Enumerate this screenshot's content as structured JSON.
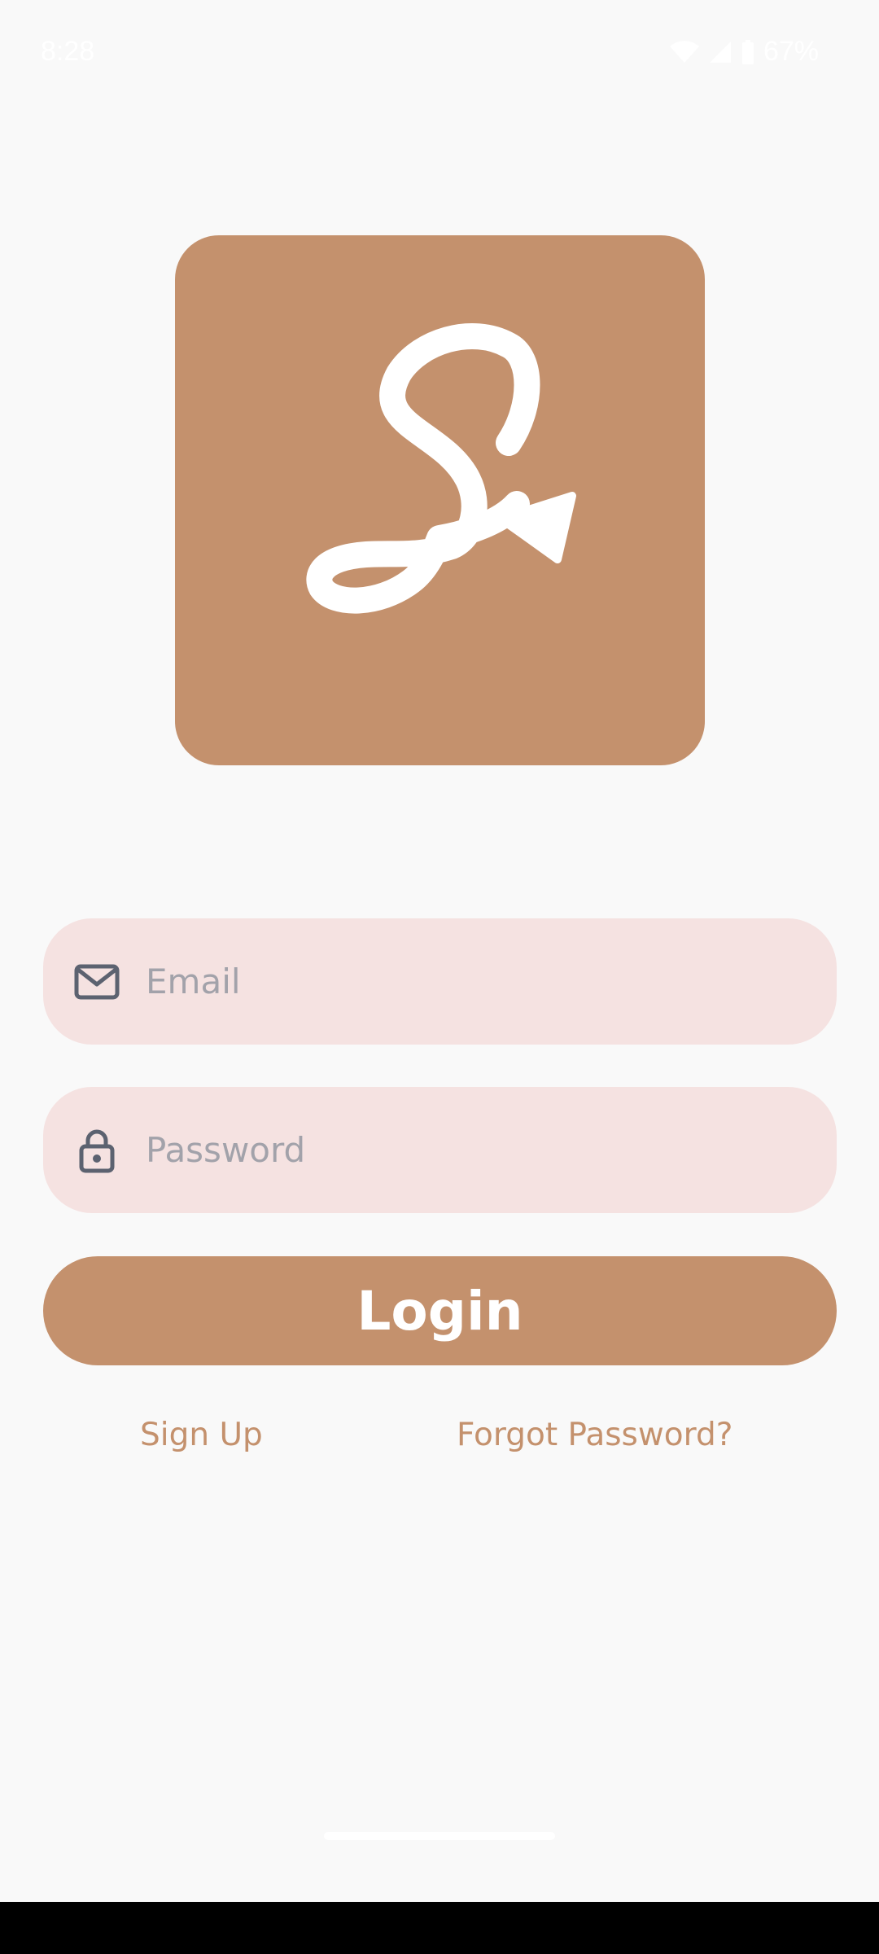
{
  "status_bar": {
    "time": "8:28",
    "battery_percent": "67%",
    "icons": [
      "wifi-icon",
      "signal-icon",
      "battery-icon"
    ]
  },
  "logo": {
    "icon": "signature-s-arrow-logo",
    "background_color": "#c4916d"
  },
  "login_form": {
    "email": {
      "placeholder": "Email",
      "value": "",
      "icon": "mail-icon"
    },
    "password": {
      "placeholder": "Password",
      "value": "",
      "icon": "lock-icon"
    },
    "login_label": "Login",
    "sign_up_label": "Sign Up",
    "forgot_password_label": "Forgot Password?"
  },
  "colors": {
    "accent": "#c4916d",
    "field_background": "#f5e2e1",
    "page_background": "#f9f9f9"
  }
}
